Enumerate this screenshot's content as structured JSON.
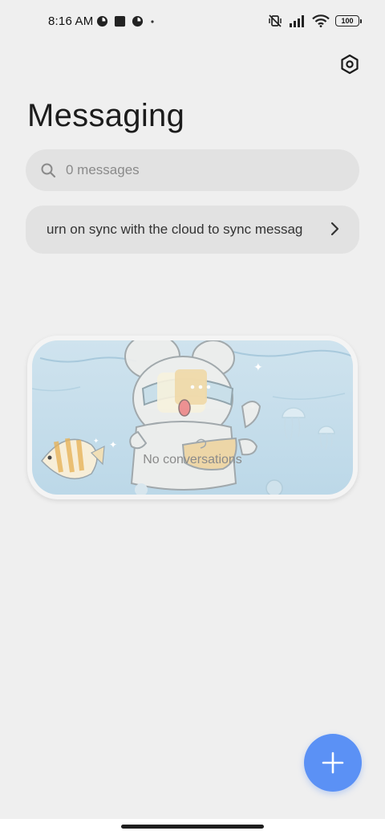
{
  "status_bar": {
    "time": "8:16 AM",
    "battery": "100",
    "left_icons": [
      "app-notification-icon",
      "square-notification-icon",
      "app-notification-icon-2",
      "dot-icon"
    ],
    "right_icons": [
      "vibrate-off-icon",
      "signal-icon",
      "wifi-icon",
      "battery-icon"
    ]
  },
  "header": {
    "title": "Messaging",
    "settings_icon": "settings-icon"
  },
  "search": {
    "placeholder": "0 messages",
    "icon": "search-icon"
  },
  "sync_banner": {
    "text": "urn on sync with the cloud to sync messag",
    "icon": "chevron-right-icon"
  },
  "empty_state": {
    "label": "No conversations",
    "illustration": "underwater-bear-illustration"
  },
  "fab": {
    "icon": "plus-icon",
    "color": "#5b91f5"
  },
  "colors": {
    "background": "#efefef",
    "surface": "#e2e2e2",
    "accent": "#5b91f5"
  }
}
